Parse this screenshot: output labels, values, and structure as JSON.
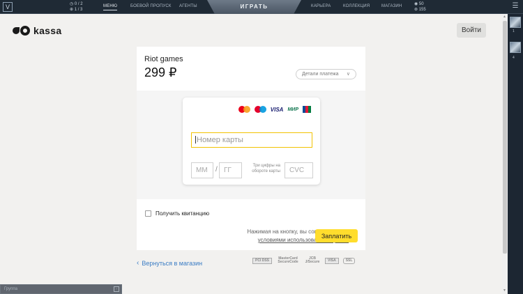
{
  "game_nav": {
    "counter_top": "0 / 2",
    "counter_bottom": "1 / 3",
    "items_left": [
      "МЕНЮ",
      "БОЕВОЙ ПРОПУСК",
      "АГЕНТЫ"
    ],
    "play": "ИГРАТЬ",
    "items_right": [
      "КАРЬЕРА",
      "КОЛЛЕКЦИЯ",
      "МАГАЗИН"
    ],
    "currency_top": "50",
    "currency_bottom": "155",
    "side_counts": [
      "1",
      "4"
    ]
  },
  "header": {
    "logo_text": "kassa",
    "login_label": "Войти"
  },
  "payment": {
    "merchant": "Riot games",
    "amount": "299 ₽",
    "details_label": "Детали платежа",
    "card_logos": [
      "mastercard-icon",
      "maestro-icon",
      "VISA",
      "МИР",
      "jcb-icon"
    ],
    "visa_text": "VISA",
    "mir_text": "МИР",
    "card_number_placeholder": "Номер карты",
    "month_placeholder": "ММ",
    "year_placeholder": "ГГ",
    "slash": "/",
    "cvc_hint": "Три цифры на обороте карты",
    "cvc_placeholder": "CVC",
    "receipt_label": "Получить квитанцию",
    "agree_text": "Нажимая на кнопку, вы соглашаетесь с",
    "agree_link": "условиями использования сервиса",
    "pay_label": "Заплатить"
  },
  "footer": {
    "back_label": "Вернуться в магазин",
    "badges": [
      "PCI DSS",
      "MasterCard SecureCode",
      "JCB J/Secure",
      "VISA",
      "SSL"
    ]
  },
  "chat": {
    "placeholder": "Группа"
  },
  "colors": {
    "accent_yellow": "#ffdd2d",
    "link_blue": "#3a7cc4",
    "nav_bg": "#1f2a35"
  }
}
